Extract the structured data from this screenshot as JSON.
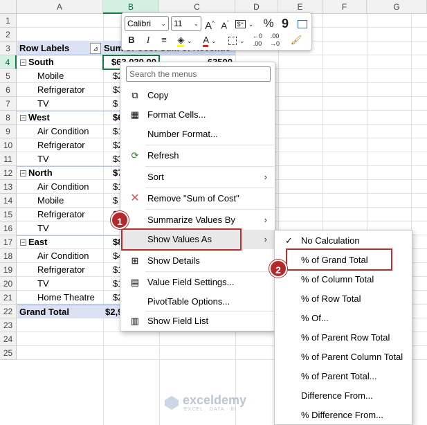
{
  "columns": [
    "A",
    "B",
    "C",
    "D",
    "E",
    "F",
    "G"
  ],
  "rows": [
    "1",
    "2",
    "3",
    "4",
    "5",
    "6",
    "7",
    "8",
    "9",
    "10",
    "11",
    "12",
    "13",
    "14",
    "15",
    "16",
    "17",
    "18",
    "19",
    "20",
    "21",
    "22",
    "23",
    "24",
    "25"
  ],
  "pivot": {
    "header_row_labels": "Row Labels",
    "header_b": "Sum of Cost",
    "header_c": "Sum of Revenue",
    "row4_b": "$63,030.00",
    "row4_c": "63500",
    "items": [
      {
        "label": "South",
        "type": "region",
        "b": "$6"
      },
      {
        "label": "Mobile",
        "type": "item",
        "b": "$2"
      },
      {
        "label": "Refrigerator",
        "type": "item",
        "b": "$3"
      },
      {
        "label": "TV",
        "type": "item",
        "b": "$"
      },
      {
        "label": "West",
        "type": "region",
        "b": "$6"
      },
      {
        "label": "Air Condition",
        "type": "item",
        "b": "$1"
      },
      {
        "label": "Refrigerator",
        "type": "item",
        "b": "$2"
      },
      {
        "label": "TV",
        "type": "item",
        "b": "$3"
      },
      {
        "label": "North",
        "type": "region",
        "b": "$7"
      },
      {
        "label": "Air Condition",
        "type": "item",
        "b": "$1"
      },
      {
        "label": "Mobile",
        "type": "item",
        "b": "$"
      },
      {
        "label": "Refrigerator",
        "type": "item",
        "b": "$"
      },
      {
        "label": "TV",
        "type": "item",
        "b": ""
      },
      {
        "label": "East",
        "type": "region",
        "b": "$8"
      },
      {
        "label": "Air Condition",
        "type": "item",
        "b": "$4"
      },
      {
        "label": "Refrigerator",
        "type": "item",
        "b": "$1"
      },
      {
        "label": "TV",
        "type": "item",
        "b": "$1"
      },
      {
        "label": "Home Theatre",
        "type": "item",
        "b": "$2"
      }
    ],
    "grand_total_label": "Grand Total",
    "grand_total_b": "$2,9"
  },
  "mini_toolbar": {
    "font_name": "Calibri",
    "font_size": "11",
    "grow": "A",
    "shrink": "A",
    "percent": "%",
    "comma": "9",
    "bold": "B",
    "italic": "I"
  },
  "context_menu": {
    "search_placeholder": "Search the menus",
    "copy": "Copy",
    "format_cells": "Format Cells...",
    "number_format": "Number Format...",
    "refresh": "Refresh",
    "sort": "Sort",
    "remove": "Remove \"Sum of Cost\"",
    "summarize": "Summarize Values By",
    "show_values_as": "Show Values As",
    "show_details": "Show Details",
    "value_field_settings": "Value Field Settings...",
    "pivottable_options": "PivotTable Options...",
    "show_field_list": "Show Field List"
  },
  "submenu": {
    "items": [
      "No Calculation",
      "% of Grand Total",
      "% of Column Total",
      "% of Row Total",
      "% Of...",
      "% of Parent Row Total",
      "% of Parent Column Total",
      "% of Parent Total...",
      "Difference From...",
      "% Difference From..."
    ]
  },
  "badges": [
    "1",
    "2"
  ],
  "watermark": {
    "name": "exceldemy",
    "tag": "EXCEL · DATA · BI"
  },
  "colors": {
    "accent_green": "#107c41",
    "pivot_header": "#d9e1f2",
    "callout_red": "#b42a2a"
  }
}
